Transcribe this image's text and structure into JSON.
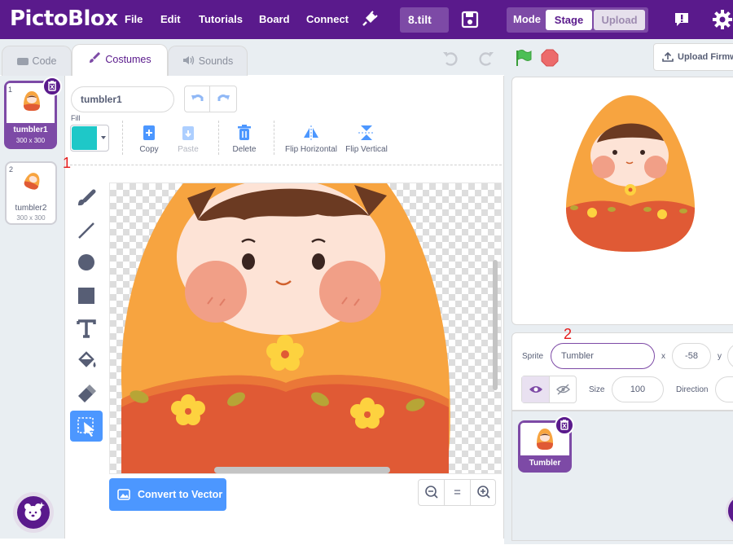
{
  "app": {
    "logo": "PictoBlox"
  },
  "menu": {
    "file": "File",
    "edit": "Edit",
    "tutorials": "Tutorials",
    "board": "Board",
    "connect": "Connect"
  },
  "project": {
    "title": "8.tilt"
  },
  "mode": {
    "label": "Mode",
    "stage": "Stage",
    "upload": "Upload"
  },
  "upload_firmware": "Upload Firmw",
  "tabs": {
    "code": "Code",
    "costumes": "Costumes",
    "sounds": "Sounds"
  },
  "costumes": [
    {
      "index": "1",
      "name": "tumbler1",
      "size": "300 x 300",
      "selected": true
    },
    {
      "index": "2",
      "name": "tumbler2",
      "size": "300 x 300",
      "selected": false
    }
  ],
  "editor": {
    "costume_name": "tumbler1",
    "fill_label": "Fill",
    "fill_color": "#1ec8c8",
    "copy": "Copy",
    "paste": "Paste",
    "delete": "Delete",
    "flip_h": "Flip Horizontal",
    "flip_v": "Flip Vertical",
    "convert": "Convert to Vector",
    "zoom_reset": "="
  },
  "annotations": {
    "a1": "1",
    "a2": "2"
  },
  "sprite": {
    "label": "Sprite",
    "name": "Tumbler",
    "x_label": "x",
    "x_value": "-58",
    "y_label": "y",
    "size_label": "Size",
    "size_value": "100",
    "direction_label": "Direction"
  },
  "sprite_list": [
    {
      "name": "Tumbler"
    }
  ],
  "colors": {
    "brand": "#5a1a8c",
    "accent": "#4c97ff",
    "doll_orange": "#f7a440",
    "doll_red": "#e05a35"
  }
}
